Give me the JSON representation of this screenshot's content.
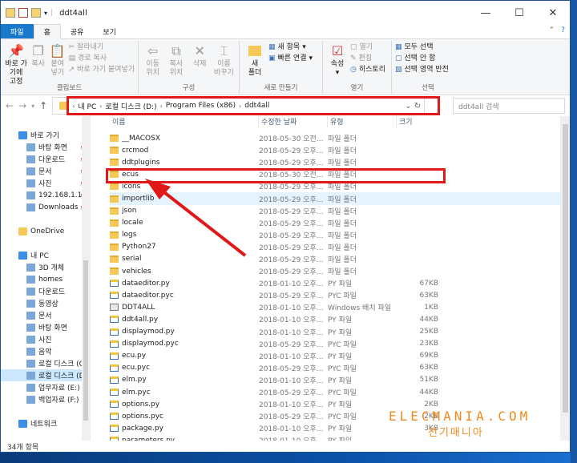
{
  "window": {
    "title": "ddt4all"
  },
  "tabs": {
    "file": "파일",
    "home": "홈",
    "share": "공유",
    "view": "보기"
  },
  "ribbon": {
    "clipboard": {
      "label": "클립보드",
      "pin": "바로 가기에\n고정",
      "copy": "복사",
      "paste": "붙여넣기",
      "cut": "잘라내기",
      "copy_path": "경로 복사",
      "paste_shortcut": "바로 가기 붙여넣기"
    },
    "organize": {
      "label": "구성",
      "move": "이동\n위치",
      "copy": "복사\n위치",
      "delete": "삭제",
      "rename": "이름\n바꾸기"
    },
    "new": {
      "label": "새로 만들기",
      "new_folder": "새\n폴더",
      "new_item": "새 항목",
      "easy_access": "빠른 연결"
    },
    "open": {
      "label": "열기",
      "properties": "속성",
      "open": "열기",
      "edit": "편집",
      "history": "히스토리"
    },
    "select": {
      "label": "선택",
      "select_all": "모두 선택",
      "select_none": "선택 안 함",
      "invert": "선택 영역 반전"
    }
  },
  "address": {
    "crumbs": [
      "내 PC",
      "로컬 디스크 (D:)",
      "Program Files (x86)",
      "ddt4all"
    ],
    "search_placeholder": "ddt4all 검색"
  },
  "sidebar": {
    "items": [
      {
        "label": "바로 가기",
        "indent": false
      },
      {
        "label": "바탕 화면",
        "indent": true,
        "pin": "📌"
      },
      {
        "label": "다운로드",
        "indent": true,
        "pin": "📌"
      },
      {
        "label": "문서",
        "indent": true,
        "pin": "📌"
      },
      {
        "label": "사진",
        "indent": true,
        "pin": "📌"
      },
      {
        "label": "192.168.1.18",
        "indent": true,
        "pin": "📌"
      },
      {
        "label": "Downloads",
        "indent": true,
        "pin": "📌"
      },
      {
        "label": "",
        "indent": false
      },
      {
        "label": "OneDrive",
        "indent": false
      },
      {
        "label": "",
        "indent": false
      },
      {
        "label": "내 PC",
        "indent": false
      },
      {
        "label": "3D 개체",
        "indent": true
      },
      {
        "label": "homes",
        "indent": true
      },
      {
        "label": "다운로드",
        "indent": true
      },
      {
        "label": "동영상",
        "indent": true
      },
      {
        "label": "문서",
        "indent": true
      },
      {
        "label": "바탕 화면",
        "indent": true
      },
      {
        "label": "사진",
        "indent": true
      },
      {
        "label": "음악",
        "indent": true
      },
      {
        "label": "로컬 디스크 (C:)",
        "indent": true
      },
      {
        "label": "로컬 디스크 (D:)",
        "indent": true,
        "selected": true
      },
      {
        "label": "업무자료 (E:)",
        "indent": true
      },
      {
        "label": "백업자료 (F:)",
        "indent": true
      },
      {
        "label": "",
        "indent": false
      },
      {
        "label": "네트워크",
        "indent": false
      }
    ]
  },
  "columns": {
    "name": "이름",
    "date": "수정한 날짜",
    "type": "유형",
    "size": "크기"
  },
  "files": [
    {
      "name": "__MACOSX",
      "date": "2018-05-30 오전...",
      "type": "파일 폴더",
      "size": "",
      "kind": "folder"
    },
    {
      "name": "crcmod",
      "date": "2018-05-29 오후...",
      "type": "파일 폴더",
      "size": "",
      "kind": "folder"
    },
    {
      "name": "ddtplugins",
      "date": "2018-05-29 오후...",
      "type": "파일 폴더",
      "size": "",
      "kind": "folder"
    },
    {
      "name": "ecus",
      "date": "2018-05-30 오전...",
      "type": "파일 폴더",
      "size": "",
      "kind": "folder"
    },
    {
      "name": "icons",
      "date": "2018-05-29 오후...",
      "type": "파일 폴더",
      "size": "",
      "kind": "folder"
    },
    {
      "name": "importlib",
      "date": "2018-05-29 오후...",
      "type": "파일 폴더",
      "size": "",
      "kind": "folder",
      "hover": true
    },
    {
      "name": "json",
      "date": "2018-05-29 오후...",
      "type": "파일 폴더",
      "size": "",
      "kind": "folder"
    },
    {
      "name": "locale",
      "date": "2018-05-29 오후...",
      "type": "파일 폴더",
      "size": "",
      "kind": "folder"
    },
    {
      "name": "logs",
      "date": "2018-05-29 오후...",
      "type": "파일 폴더",
      "size": "",
      "kind": "folder"
    },
    {
      "name": "Python27",
      "date": "2018-05-29 오후...",
      "type": "파일 폴더",
      "size": "",
      "kind": "folder"
    },
    {
      "name": "serial",
      "date": "2018-05-29 오후...",
      "type": "파일 폴더",
      "size": "",
      "kind": "folder"
    },
    {
      "name": "vehicles",
      "date": "2018-05-29 오후...",
      "type": "파일 폴더",
      "size": "",
      "kind": "folder"
    },
    {
      "name": "dataeditor.py",
      "date": "2018-01-10 오후...",
      "type": "PY 파일",
      "size": "67KB",
      "kind": "py"
    },
    {
      "name": "dataeditor.pyc",
      "date": "2018-05-29 오후...",
      "type": "PYC 파일",
      "size": "63KB",
      "kind": "py"
    },
    {
      "name": "DDT4ALL",
      "date": "2018-01-10 오후...",
      "type": "Windows 배치 파일",
      "size": "1KB",
      "kind": "bat"
    },
    {
      "name": "ddt4all.py",
      "date": "2018-01-10 오후...",
      "type": "PY 파일",
      "size": "44KB",
      "kind": "py"
    },
    {
      "name": "displaymod.py",
      "date": "2018-01-10 오후...",
      "type": "PY 파일",
      "size": "25KB",
      "kind": "py"
    },
    {
      "name": "displaymod.pyc",
      "date": "2018-05-29 오후...",
      "type": "PYC 파일",
      "size": "23KB",
      "kind": "py"
    },
    {
      "name": "ecu.py",
      "date": "2018-01-10 오후...",
      "type": "PY 파일",
      "size": "69KB",
      "kind": "py"
    },
    {
      "name": "ecu.pyc",
      "date": "2018-05-29 오후...",
      "type": "PYC 파일",
      "size": "63KB",
      "kind": "py"
    },
    {
      "name": "elm.py",
      "date": "2018-01-10 오후...",
      "type": "PY 파일",
      "size": "51KB",
      "kind": "py"
    },
    {
      "name": "elm.pyc",
      "date": "2018-05-29 오후...",
      "type": "PYC 파일",
      "size": "44KB",
      "kind": "py"
    },
    {
      "name": "options.py",
      "date": "2018-01-10 오후...",
      "type": "PY 파일",
      "size": "2KB",
      "kind": "py"
    },
    {
      "name": "options.pyc",
      "date": "2018-05-29 오후...",
      "type": "PYC 파일",
      "size": "2KB",
      "kind": "py"
    },
    {
      "name": "package.py",
      "date": "2018-01-10 오후...",
      "type": "PY 파일",
      "size": "3KB",
      "kind": "py"
    },
    {
      "name": "parameters.py",
      "date": "2018-01-10 오후...",
      "type": "PY 파일",
      "size": "",
      "kind": "py"
    }
  ],
  "status": {
    "count": "34개 항목"
  },
  "watermark": {
    "line1": "ELECMANIA.COM",
    "line2": "전기매니아"
  },
  "colors": {
    "accent": "#1979ca",
    "highlight": "#e01818",
    "watermark": "#f08a1d"
  }
}
